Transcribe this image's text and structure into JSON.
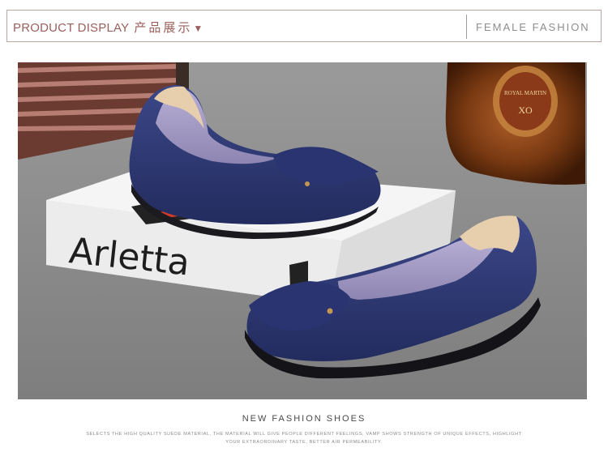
{
  "header": {
    "left_en": "PRODUCT DISPLAY",
    "left_zh": "产品展示",
    "left_arrow": "▼",
    "right": "FEMALE FASHION"
  },
  "photo": {
    "box_brand": "Arletta",
    "bottle_label_line1": "ROYAL MARTIN",
    "bottle_label_line2": "XO",
    "colors": {
      "shoe": "#2f3a78",
      "lining": "#9c92be",
      "backdrop": "#8f8f8f",
      "box": "#f4f4f4",
      "bottle": "#7a3a12"
    }
  },
  "footer": {
    "title": "NEW FASHION SHOES",
    "desc_line1": "SELECTS THE HIGH QUALITY SUEDE MATERIAL, THE MATERIAL WILL GIVE PEOPLE DIFFERENT FEELINGS, VAMP SHOWS STRENGTH OF UNIQUE EFFECTS, HIGHLIGHT",
    "desc_line2": "YOUR EXTRAORDINARY TASTE, BETTER AIR PERMEABILITY."
  }
}
